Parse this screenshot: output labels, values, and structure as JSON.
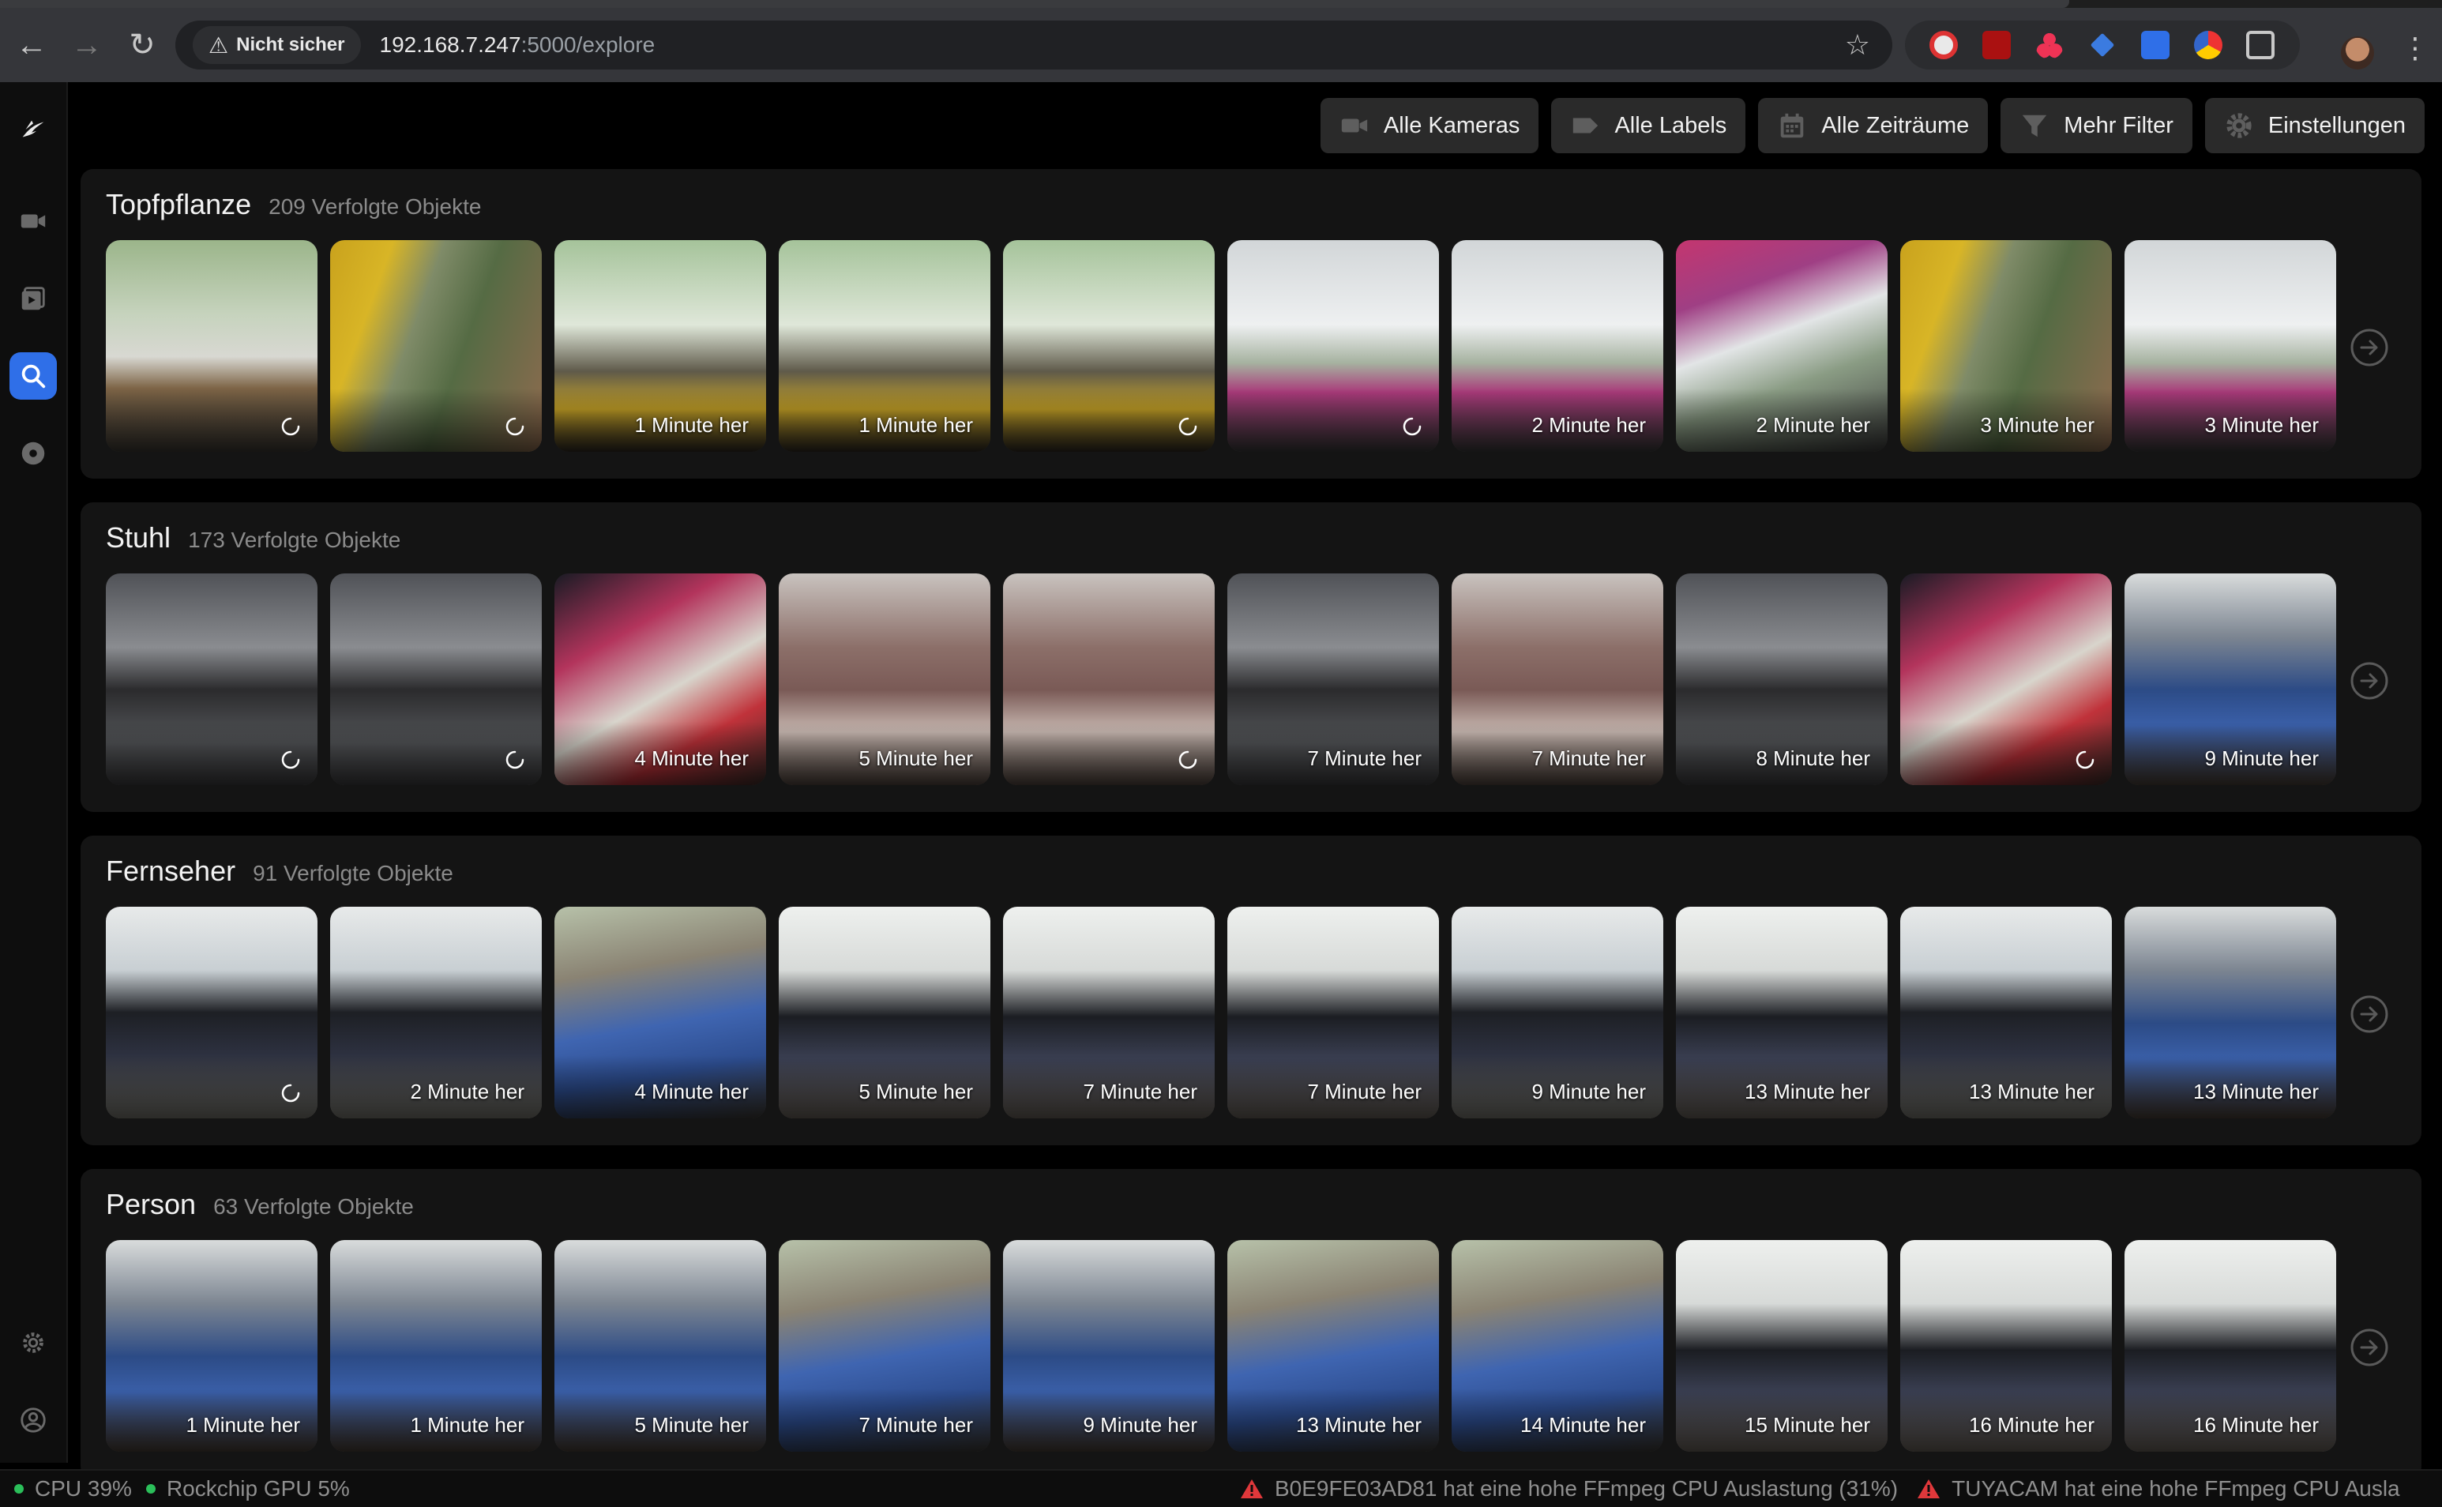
{
  "browser": {
    "security_label": "Nicht sicher",
    "url_host": "192.168.7.247",
    "url_rest": ":5000/explore"
  },
  "toolbar": {
    "cameras": "Alle Kameras",
    "labels": "Alle Labels",
    "time": "Alle Zeiträume",
    "filter": "Mehr Filter",
    "settings": "Einstellungen"
  },
  "sections": [
    {
      "title": "Topfpflanze",
      "count": "209 Verfolgte Objekte",
      "items": [
        {
          "time": "",
          "palette": "p0"
        },
        {
          "time": "",
          "palette": "p1"
        },
        {
          "time": "1 Minute her",
          "palette": "p2"
        },
        {
          "time": "1 Minute her",
          "palette": "p2"
        },
        {
          "time": "",
          "palette": "p2"
        },
        {
          "time": "",
          "palette": "p3"
        },
        {
          "time": "2 Minute her",
          "palette": "p3"
        },
        {
          "time": "2 Minute her",
          "palette": "p4"
        },
        {
          "time": "3 Minute her",
          "palette": "p1"
        },
        {
          "time": "3 Minute her",
          "palette": "p3"
        }
      ]
    },
    {
      "title": "Stuhl",
      "count": "173 Verfolgte Objekte",
      "items": [
        {
          "time": "",
          "palette": "p5"
        },
        {
          "time": "",
          "palette": "p5"
        },
        {
          "time": "4 Minute her",
          "palette": "p6"
        },
        {
          "time": "5 Minute her",
          "palette": "p7"
        },
        {
          "time": "",
          "palette": "p7"
        },
        {
          "time": "7 Minute her",
          "palette": "p5"
        },
        {
          "time": "7 Minute her",
          "palette": "p7"
        },
        {
          "time": "8 Minute her",
          "palette": "p5"
        },
        {
          "time": "",
          "palette": "p6"
        },
        {
          "time": "9 Minute her",
          "palette": "p10"
        }
      ]
    },
    {
      "title": "Fernseher",
      "count": "91 Verfolgte Objekte",
      "items": [
        {
          "time": "",
          "palette": "p8"
        },
        {
          "time": "2 Minute her",
          "palette": "p8"
        },
        {
          "time": "4 Minute her",
          "palette": "p11"
        },
        {
          "time": "5 Minute her",
          "palette": "p9"
        },
        {
          "time": "7 Minute her",
          "palette": "p9"
        },
        {
          "time": "7 Minute her",
          "palette": "p9"
        },
        {
          "time": "9 Minute her",
          "palette": "p8"
        },
        {
          "time": "13 Minute her",
          "palette": "p9"
        },
        {
          "time": "13 Minute her",
          "palette": "p8"
        },
        {
          "time": "13 Minute her",
          "palette": "p10"
        }
      ]
    },
    {
      "title": "Person",
      "count": "63 Verfolgte Objekte",
      "items": [
        {
          "time": "1 Minute her",
          "palette": "p10"
        },
        {
          "time": "1 Minute her",
          "palette": "p10"
        },
        {
          "time": "5 Minute her",
          "palette": "p10"
        },
        {
          "time": "7 Minute her",
          "palette": "p11"
        },
        {
          "time": "9 Minute her",
          "palette": "p10"
        },
        {
          "time": "13 Minute her",
          "palette": "p11"
        },
        {
          "time": "14 Minute her",
          "palette": "p11"
        },
        {
          "time": "15 Minute her",
          "palette": "p9"
        },
        {
          "time": "16 Minute her",
          "palette": "p9"
        },
        {
          "time": "16 Minute her",
          "palette": "p9"
        }
      ]
    }
  ],
  "status": {
    "cpu": "CPU 39%",
    "gpu": "Rockchip GPU 5%",
    "warning1": "B0E9FE03AD81 hat eine hohe FFmpeg CPU Auslastung (31%)",
    "warning2": "TUYACAM hat eine hohe FFmpeg CPU Ausla"
  },
  "colors": {
    "accent": "#2f6fe8",
    "status_ok": "#2bbf5a",
    "warning": "#e0383b"
  }
}
